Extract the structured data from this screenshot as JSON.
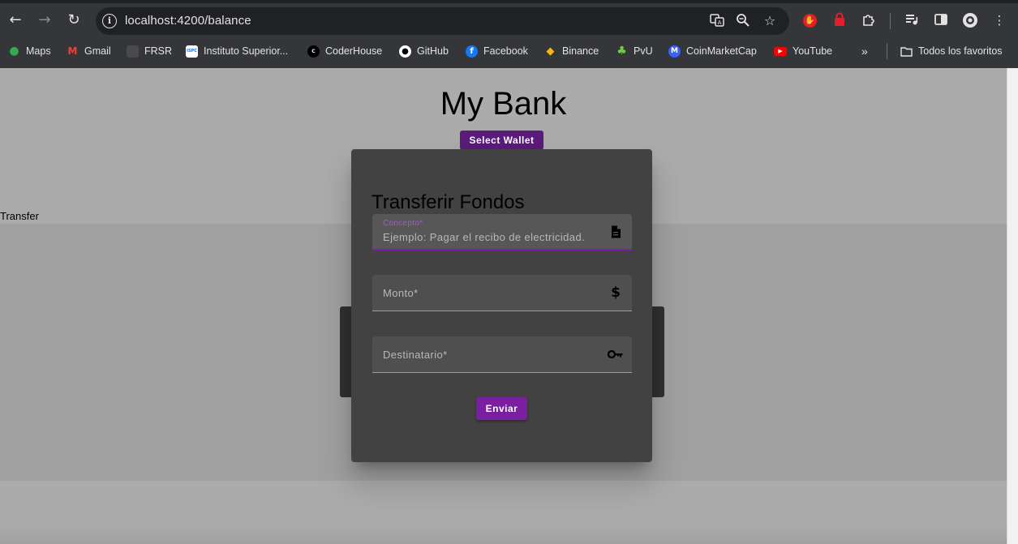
{
  "browser": {
    "url": "localhost:4200/balance",
    "bookmarks": [
      {
        "label": "Maps",
        "icon": "maps-icon",
        "color": "#34a853"
      },
      {
        "label": "Gmail",
        "icon": "gmail-icon",
        "color": "#ea4335"
      },
      {
        "label": "FRSR",
        "icon": "frsr-icon",
        "color": "#555555"
      },
      {
        "label": "Instituto Superior...",
        "icon": "ispc-icon",
        "color": "#ffffff"
      },
      {
        "label": "CoderHouse",
        "icon": "coderhouse-icon",
        "color": "#000000"
      },
      {
        "label": "GitHub",
        "icon": "github-icon",
        "color": "#ffffff"
      },
      {
        "label": "Facebook",
        "icon": "facebook-icon",
        "color": "#1877f2"
      },
      {
        "label": "Binance",
        "icon": "binance-icon",
        "color": "#f0b90b"
      },
      {
        "label": "PvU",
        "icon": "pvu-icon",
        "color": "#6fcf3f"
      },
      {
        "label": "CoinMarketCap",
        "icon": "coinmarketcap-icon",
        "color": "#3861fb"
      },
      {
        "label": "YouTube",
        "icon": "youtube-icon",
        "color": "#ff0000"
      }
    ],
    "all_bookmarks_label": "Todos los favoritos"
  },
  "page": {
    "title": "My Bank",
    "select_wallet_label": "Select Wallet",
    "transfer_label": "Transfer"
  },
  "dialog": {
    "title": "Transferir Fondos",
    "concept": {
      "label": "Concepto*",
      "placeholder": "Ejemplo: Pagar el recibo de electricidad.",
      "icon": "document-icon"
    },
    "amount": {
      "label": "Monto*",
      "icon": "dollar-icon"
    },
    "recipient": {
      "label": "Destinatario*",
      "icon": "key-icon"
    },
    "send_label": "Enviar"
  },
  "colors": {
    "accent": "#7b1fa2",
    "wallet_button": "#5a1b7a",
    "dialog_bg": "#424242",
    "page_bg": "#ababab"
  }
}
